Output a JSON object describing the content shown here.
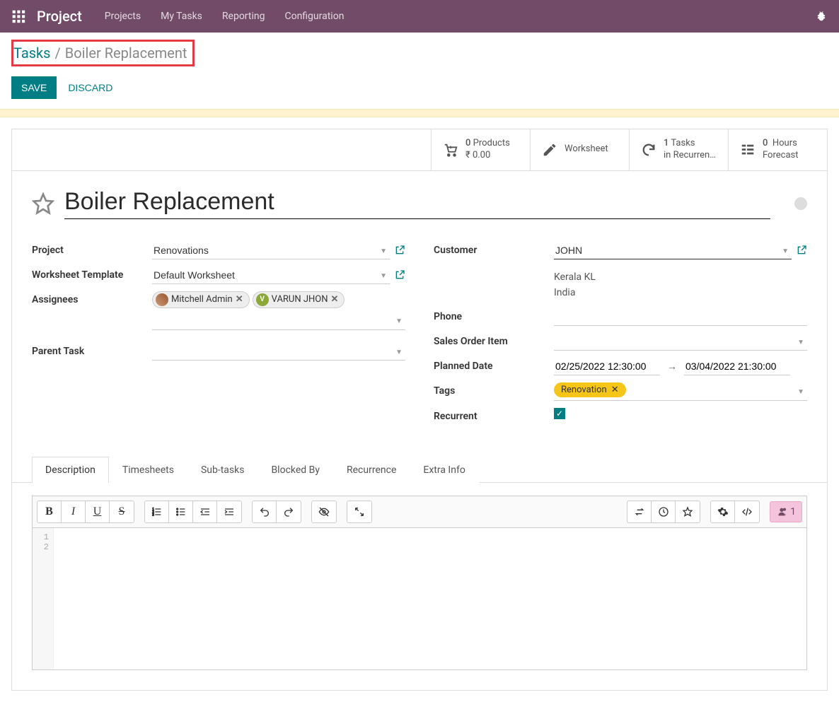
{
  "navbar": {
    "brand": "Project",
    "links": [
      "Projects",
      "My Tasks",
      "Reporting",
      "Configuration"
    ]
  },
  "breadcrumb": {
    "root": "Tasks",
    "current": "Boiler Replacement"
  },
  "actions": {
    "save": "SAVE",
    "discard": "DISCARD"
  },
  "stats": {
    "products": {
      "count": "0",
      "label": "Products",
      "sub": "₹ 0.00"
    },
    "worksheet": {
      "label": "Worksheet"
    },
    "recurrence": {
      "count": "1",
      "label": "Tasks",
      "sub": "in Recurren…"
    },
    "forecast": {
      "count": "0",
      "unit": "Hours",
      "sub": "Forecast"
    }
  },
  "title": "Boiler Replacement",
  "left_fields": {
    "project_label": "Project",
    "project_value": "Renovations",
    "worksheet_tpl_label": "Worksheet Template",
    "worksheet_tpl_value": "Default Worksheet",
    "assignees_label": "Assignees",
    "assignees": [
      {
        "initial": "",
        "name": "Mitchell Admin",
        "style": "img"
      },
      {
        "initial": "V",
        "name": "VARUN JHON",
        "style": "green"
      }
    ],
    "parent_task_label": "Parent Task",
    "parent_task_value": ""
  },
  "right_fields": {
    "customer_label": "Customer",
    "customer_value": "JOHN",
    "address_line1": "Kerala KL",
    "address_line2": "India",
    "phone_label": "Phone",
    "phone_value": "",
    "sales_order_label": "Sales Order Item",
    "sales_order_value": "",
    "planned_date_label": "Planned Date",
    "planned_start": "02/25/2022 12:30:00",
    "planned_end": "03/04/2022 21:30:00",
    "tags_label": "Tags",
    "tags": [
      "Renovation"
    ],
    "recurrent_label": "Recurrent",
    "recurrent_checked": true
  },
  "tabs": [
    "Description",
    "Timesheets",
    "Sub-tasks",
    "Blocked By",
    "Recurrence",
    "Extra Info"
  ],
  "active_tab": "Description",
  "editor": {
    "gutter_lines": [
      "1",
      "2"
    ],
    "collaborators_count": "1"
  }
}
